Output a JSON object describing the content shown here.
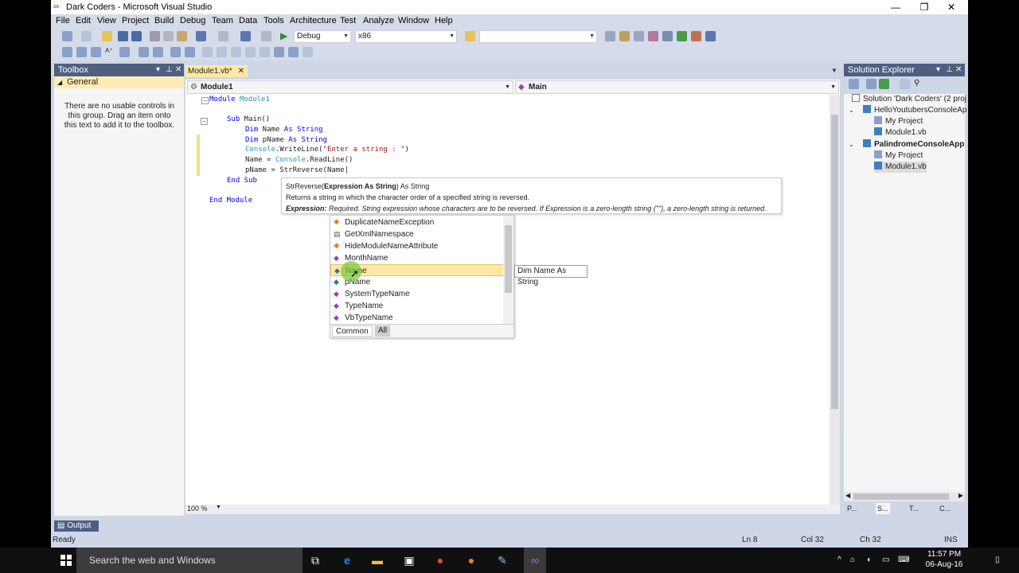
{
  "window": {
    "title": "Dark Coders - Microsoft Visual Studio"
  },
  "menu": [
    "File",
    "Edit",
    "View",
    "Project",
    "Build",
    "Debug",
    "Team",
    "Data",
    "Tools",
    "Architecture",
    "Test",
    "Analyze",
    "Window",
    "Help"
  ],
  "toolbar": {
    "config": "Debug",
    "platform": "x86",
    "find_value": ""
  },
  "toolbox": {
    "title": "Toolbox",
    "group": "General",
    "message": "There are no usable controls in this group. Drag an item onto this text to add it to the toolbox."
  },
  "editor": {
    "tab_label": "Module1.vb*",
    "nav_left": "Module1",
    "nav_right": "Main",
    "zoom": "100 %"
  },
  "quickinfo": {
    "sig_name": "StrReverse(",
    "sig_param": "Expression As String",
    "sig_return": ") As String",
    "summary": "Returns a string in which the character order of a specified string is reversed.",
    "param_label": "Expression:",
    "param_desc": "Required. String expression whose characters are to be reversed. If Expression is a zero-length string (\"\"), a zero-length string is returned."
  },
  "completion": {
    "items": [
      {
        "label": "DuplicateNameException",
        "icon": "class-icon"
      },
      {
        "label": "GetXmlNamespace",
        "icon": "keyword-icon"
      },
      {
        "label": "HideModuleNameAttribute",
        "icon": "class-icon"
      },
      {
        "label": "MonthName",
        "icon": "method-icon"
      },
      {
        "label": "Name",
        "icon": "local-variable-icon"
      },
      {
        "label": "pName",
        "icon": "local-variable-icon"
      },
      {
        "label": "SystemTypeName",
        "icon": "method-icon"
      },
      {
        "label": "TypeName",
        "icon": "method-icon"
      },
      {
        "label": "VbTypeName",
        "icon": "method-icon"
      }
    ],
    "selected_index": 4,
    "tabs": [
      "Common",
      "All"
    ],
    "tooltip": "Dim Name As String"
  },
  "solution_explorer": {
    "title": "Solution Explorer",
    "items": [
      {
        "label": "Solution 'Dark Coders' (2 proj",
        "icon": "solution-icon"
      },
      {
        "label": "HelloYoutubersConsoleAp",
        "icon": "vb-project-icon"
      },
      {
        "label": "My Project",
        "icon": "my-project-icon"
      },
      {
        "label": "Module1.vb",
        "icon": "vb-file-icon"
      },
      {
        "label": "PalindromeConsoleApp",
        "icon": "vb-project-icon"
      },
      {
        "label": "My Project",
        "icon": "my-project-icon"
      },
      {
        "label": "Module1.vb",
        "icon": "vb-file-icon"
      }
    ],
    "tabs": [
      "P...",
      "S...",
      "T...",
      "C..."
    ]
  },
  "output_tab": "Output",
  "status": {
    "ready": "Ready",
    "ln": "Ln 8",
    "col": "Col 32",
    "ch": "Ch 32",
    "mode": "INS"
  },
  "taskbar": {
    "search_placeholder": "Search the web and Windows",
    "time": "11:57 PM",
    "date": "06-Aug-16"
  }
}
